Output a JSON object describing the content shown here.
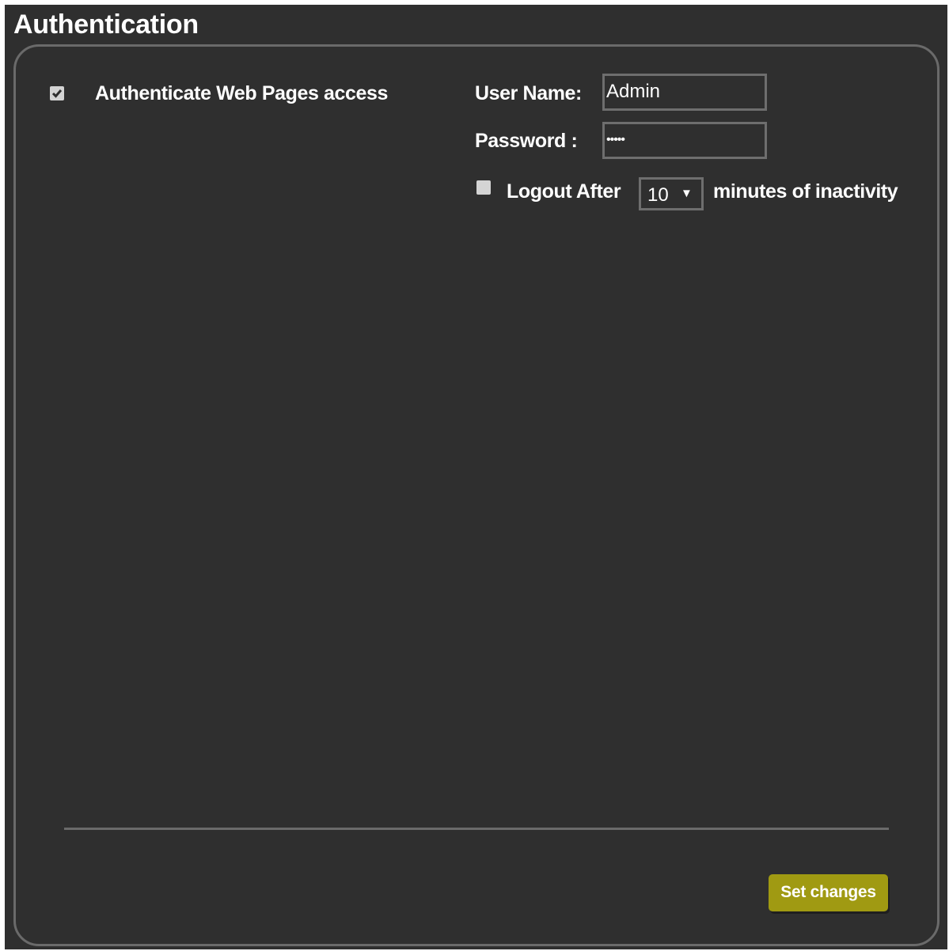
{
  "page": {
    "title": "Authentication"
  },
  "auth": {
    "authenticate_label": "Authenticate Web Pages access",
    "authenticate_checked": true,
    "user_name_label": "User Name:",
    "user_name_value": "Admin",
    "password_label": "Password :",
    "password_value": "•••••",
    "logout_checked": false,
    "logout_after_label": "Logout After",
    "logout_minutes_value": "10",
    "logout_arrow": "▼",
    "minutes_label": "minutes of inactivity"
  },
  "actions": {
    "set_changes_label": "Set changes"
  },
  "colors": {
    "background": "#2f2f2f",
    "panel_border": "#6a6a6a",
    "button": "#a09a12",
    "text": "#ffffff"
  }
}
